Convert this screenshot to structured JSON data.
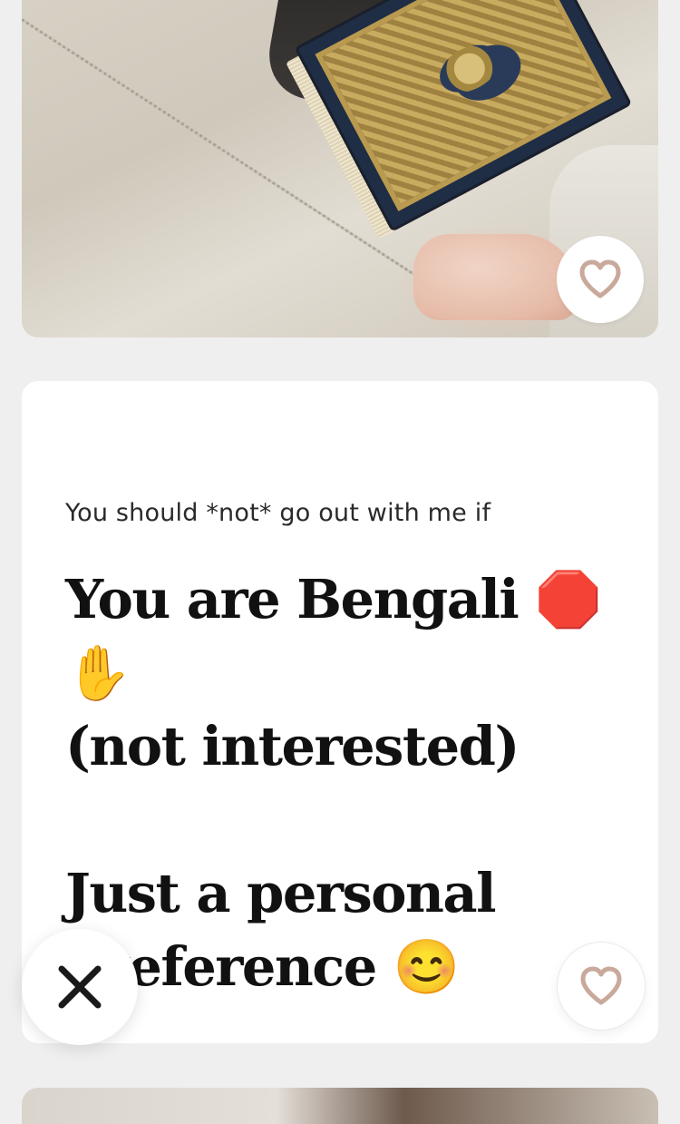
{
  "photo_card": {
    "like_icon": "heart-outline-icon"
  },
  "prompt_card": {
    "prompt": "You should *not* go out with me if",
    "answer_lines": [
      "You are Bengali 🛑✋",
      "(not interested)",
      "",
      "Just a personal",
      "preference 😊"
    ],
    "like_icon": "heart-outline-icon"
  },
  "actions": {
    "skip_icon": "close-x-icon"
  },
  "colors": {
    "background": "#f0efef",
    "card": "#ffffff",
    "heart_stroke": "#c9a99b",
    "text": "#111111"
  }
}
